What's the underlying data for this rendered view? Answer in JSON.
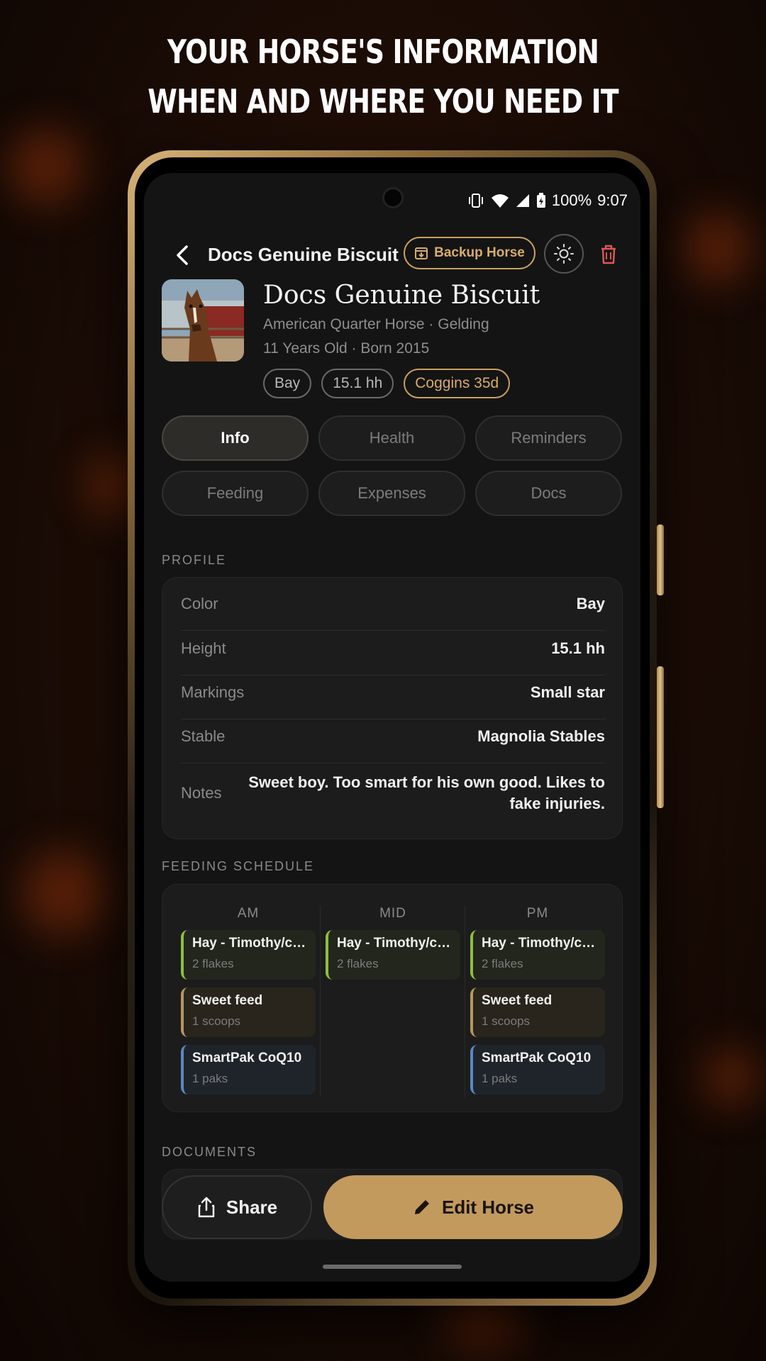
{
  "headline": {
    "line1": "YOUR HORSE'S INFORMATION",
    "line2": "WHEN AND WHERE YOU NEED IT"
  },
  "status_bar": {
    "battery": "100%",
    "time": "9:07"
  },
  "header": {
    "title": "Docs Genuine Biscuit",
    "backup_label": "Backup Horse"
  },
  "horse": {
    "name": "Docs Genuine Biscuit",
    "breed_line": "American Quarter Horse · Gelding",
    "age_line": "11 Years Old · Born 2015",
    "chips": [
      "Bay",
      "15.1 hh",
      "Coggins 35d"
    ]
  },
  "tabs": [
    "Info",
    "Health",
    "Reminders",
    "Feeding",
    "Expenses",
    "Docs"
  ],
  "active_tab": "Info",
  "profile": {
    "label": "PROFILE",
    "rows": [
      {
        "key": "Color",
        "value": "Bay"
      },
      {
        "key": "Height",
        "value": "15.1 hh"
      },
      {
        "key": "Markings",
        "value": "Small star"
      },
      {
        "key": "Stable",
        "value": "Magnolia Stables"
      },
      {
        "key": "Notes",
        "value": "Sweet boy. Too smart for his own good. Likes to fake injuries."
      }
    ]
  },
  "feeding": {
    "label": "FEEDING SCHEDULE",
    "columns": [
      {
        "name": "AM",
        "items": [
          {
            "title": "Hay - Timothy/coa...",
            "amount": "2 flakes",
            "kind": "hay"
          },
          {
            "title": "Sweet feed",
            "amount": "1 scoops",
            "kind": "sweet"
          },
          {
            "title": "SmartPak CoQ10",
            "amount": "1 paks",
            "kind": "smart"
          }
        ]
      },
      {
        "name": "MID",
        "items": [
          {
            "title": "Hay - Timothy/coa...",
            "amount": "2 flakes",
            "kind": "hay"
          }
        ]
      },
      {
        "name": "PM",
        "items": [
          {
            "title": "Hay - Timothy/coa...",
            "amount": "2 flakes",
            "kind": "hay"
          },
          {
            "title": "Sweet feed",
            "amount": "1 scoops",
            "kind": "sweet"
          },
          {
            "title": "SmartPak CoQ10",
            "amount": "1 paks",
            "kind": "smart"
          }
        ]
      }
    ]
  },
  "documents": {
    "label": "DOCUMENTS"
  },
  "actions": {
    "share_label": "Share",
    "edit_label": "Edit Horse"
  },
  "colors": {
    "accent": "#c29a5e",
    "background": "#141414",
    "hay": "#8fbf3a",
    "sweet": "#b8965e",
    "smart": "#5a88c8"
  }
}
